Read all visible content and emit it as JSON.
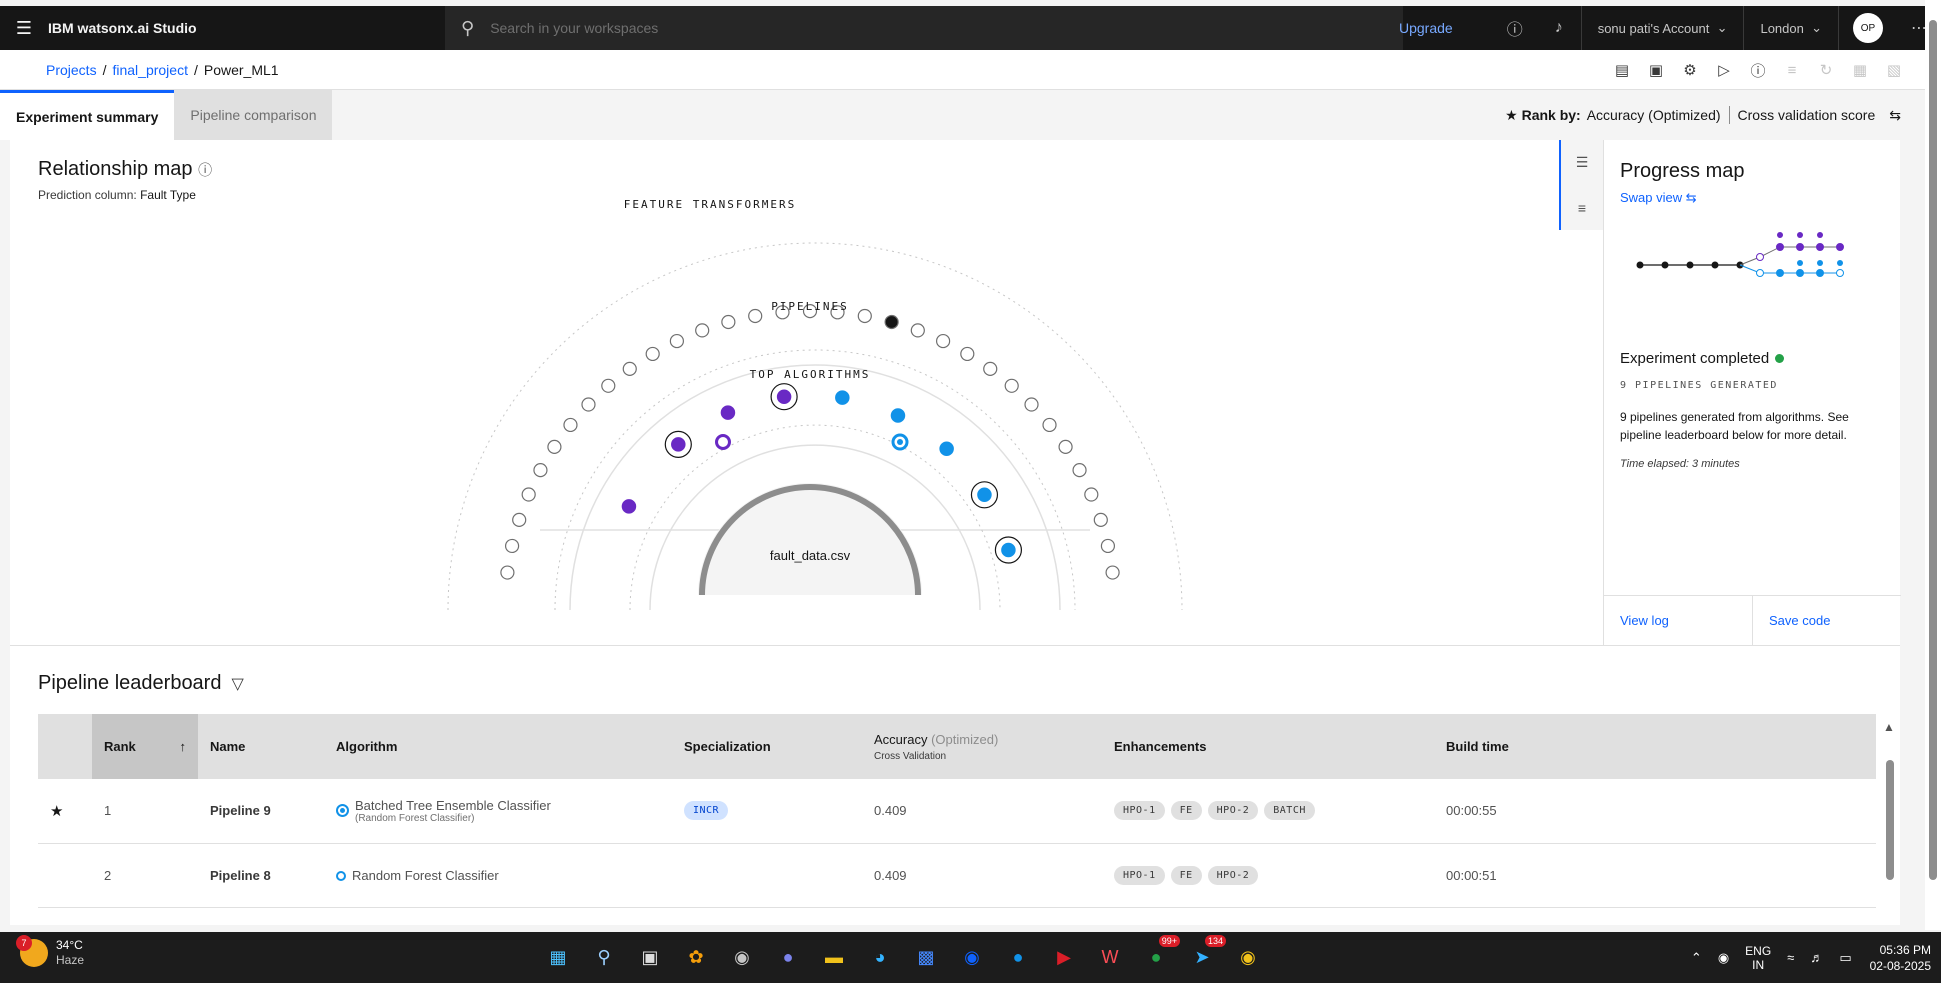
{
  "header": {
    "brand": "IBM watsonx.ai Studio",
    "search_placeholder": "Search in your workspaces",
    "upgrade": "Upgrade",
    "account": "sonu pati's Account",
    "region": "London",
    "avatar": "OP"
  },
  "breadcrumb": {
    "items": [
      "Projects",
      "final_project",
      "Power_ML1"
    ]
  },
  "tabs": [
    {
      "label": "Experiment summary",
      "active": true
    },
    {
      "label": "Pipeline comparison",
      "active": false
    }
  ],
  "rank_by": {
    "label": "Rank by:",
    "metric": "Accuracy (Optimized)",
    "scope": "Cross validation score"
  },
  "relationship_map": {
    "title": "Relationship map",
    "prediction_label": "Prediction column:",
    "prediction_value": "Fault Type",
    "ring_feature": "FEATURE TRANSFORMERS",
    "ring_pipelines": "PIPELINES",
    "ring_algorithms": "TOP ALGORITHMS",
    "center": "fault_data.csv"
  },
  "progress_map": {
    "title": "Progress map",
    "swap": "Swap view",
    "status": "Experiment completed",
    "count": "9 PIPELINES GENERATED",
    "description": "9 pipelines generated from algorithms. See pipeline leaderboard below for more detail.",
    "time": "Time elapsed: 3 minutes",
    "view_log": "View log",
    "save_code": "Save code"
  },
  "leaderboard": {
    "title": "Pipeline leaderboard",
    "columns": {
      "rank": "Rank",
      "name": "Name",
      "algorithm": "Algorithm",
      "specialization": "Specialization",
      "accuracy": "Accuracy",
      "accuracy_opt": "(Optimized)",
      "accuracy_sub": "Cross Validation",
      "enhancements": "Enhancements",
      "build_time": "Build time"
    },
    "rows": [
      {
        "rank": "1",
        "name": "Pipeline 9",
        "algorithm": "Batched Tree Ensemble Classifier",
        "algorithm_sub": "(Random Forest Classifier)",
        "specialization": "INCR",
        "accuracy": "0.409",
        "enhancements": [
          "HPO-1",
          "FE",
          "HPO-2",
          "BATCH"
        ],
        "build_time": "00:00:55"
      },
      {
        "rank": "2",
        "name": "Pipeline 8",
        "algorithm": "Random Forest Classifier",
        "algorithm_sub": "",
        "specialization": "",
        "accuracy": "0.409",
        "enhancements": [
          "HPO-1",
          "FE",
          "HPO-2"
        ],
        "build_time": "00:00:51"
      }
    ]
  },
  "taskbar": {
    "temp": "34°C",
    "weather": "Haze",
    "weather_badge": "7",
    "lang1": "ENG",
    "lang2": "IN",
    "time": "05:36 PM",
    "date": "02-08-2025",
    "whatsapp_badge": "99+",
    "telegram_badge": "134"
  },
  "colors": {
    "accent": "#0f62fe",
    "purple": "#6929c4",
    "cyan": "#1192e8",
    "success": "#24a148"
  }
}
